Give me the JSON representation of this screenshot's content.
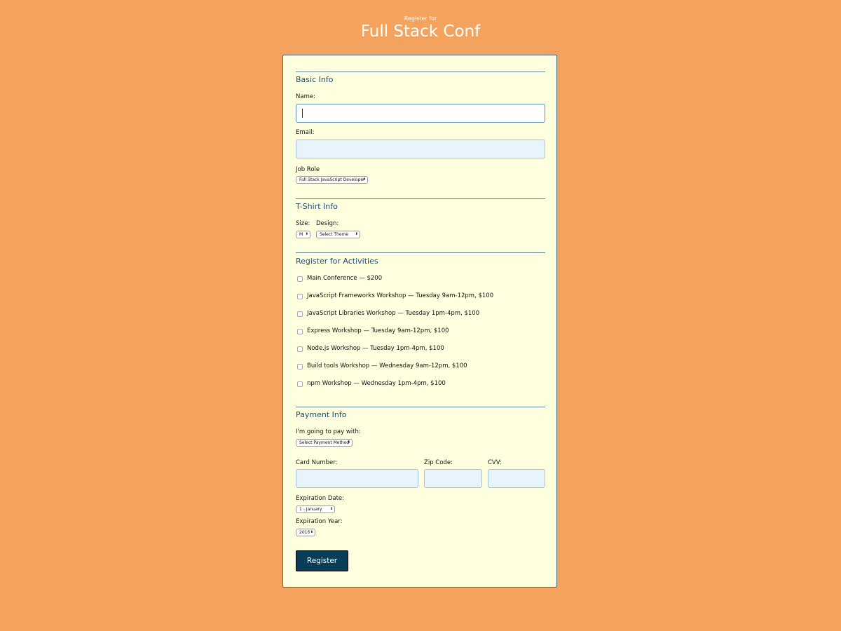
{
  "header": {
    "pretitle": "Register for",
    "title": "Full Stack Conf"
  },
  "basic_info": {
    "title": "Basic Info",
    "name_label": "Name:",
    "name_value": "",
    "email_label": "Email:",
    "email_value": "",
    "job_role_label": "Job Role",
    "job_role_selected": "Full Stack JavaScript Developer"
  },
  "tshirt_info": {
    "title": "T-Shirt Info",
    "size_label": "Size:",
    "size_selected": "M",
    "design_label": "Design:",
    "design_selected": "Select Theme"
  },
  "activities": {
    "title": "Register for Activities",
    "items": [
      {
        "label": "Main Conference — $200",
        "checked": false
      },
      {
        "label": "JavaScript Frameworks Workshop — Tuesday 9am-12pm, $100",
        "checked": false
      },
      {
        "label": "JavaScript Libraries Workshop — Tuesday 1pm-4pm, $100",
        "checked": false
      },
      {
        "label": "Express Workshop — Tuesday 9am-12pm, $100",
        "checked": false
      },
      {
        "label": "Node.js Workshop — Tuesday 1pm-4pm, $100",
        "checked": false
      },
      {
        "label": "Build tools Workshop — Wednesday 9am-12pm, $100",
        "checked": false
      },
      {
        "label": "npm Workshop — Wednesday 1pm-4pm, $100",
        "checked": false
      }
    ]
  },
  "payment_info": {
    "title": "Payment Info",
    "pay_with_label": "I'm going to pay with:",
    "pay_with_selected": "Select Payment Method",
    "card_number_label": "Card Number:",
    "zip_label": "Zip Code:",
    "cvv_label": "CVV:",
    "exp_date_label": "Expiration Date:",
    "exp_date_selected": "1 - January",
    "exp_year_label": "Expiration Year:",
    "exp_year_selected": "2016"
  },
  "submit": {
    "label": "Register"
  },
  "colors": {
    "page_background": "#f4a35f",
    "card_background": "#feffdf",
    "accent": "#1b4d6e",
    "button": "#083d57",
    "input_background": "#e8f4fc"
  }
}
